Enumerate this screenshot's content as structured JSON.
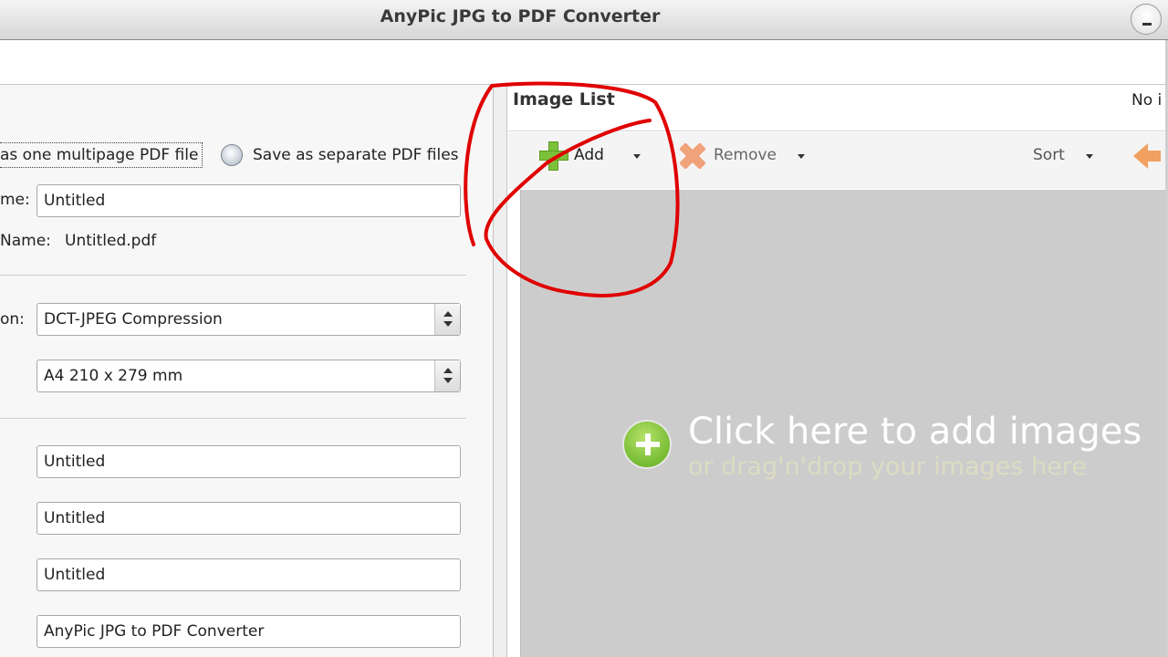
{
  "window": {
    "title": "AnyPic JPG to PDF Converter"
  },
  "left_panel": {
    "save_multipage_label": "as one multipage PDF file",
    "save_separate_label": "Save as separate PDF files",
    "file_name_label": "me:",
    "file_name_value": "Untitled",
    "output_name_label": "Name:",
    "output_name_value": "Untitled.pdf",
    "compression_label": "on:",
    "compression_value": "DCT-JPEG Compression",
    "page_size_value": "A4 210 x 279 mm",
    "title_value": "Untitled",
    "subject_value": "Untitled",
    "author_value": "Untitled",
    "creator_value": "AnyPic JPG to PDF Converter"
  },
  "image_list": {
    "title": "Image List",
    "count_text": "No i",
    "toolbar": {
      "add_label": "Add",
      "remove_label": "Remove",
      "sort_label": "Sort"
    },
    "drop_main": "Click here  to add images",
    "drop_sub": "or drag'n'drop your images here"
  },
  "icons": {
    "add": "plus-icon",
    "remove": "x-icon",
    "back": "arrow-left-icon",
    "drop": "add-circle-icon"
  },
  "colors": {
    "annotation": "#e00000",
    "add_green": "#7cc13a",
    "remove_orange": "#f0a27a",
    "drop_bg": "#cccccc"
  }
}
